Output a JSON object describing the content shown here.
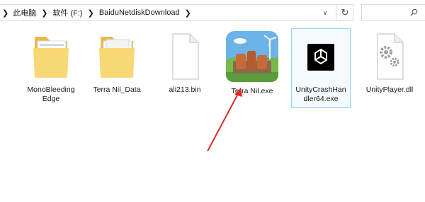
{
  "address": {
    "crumbs": [
      "此电脑",
      "软件 (F:)",
      "BaiduNetdiskDownload"
    ],
    "refresh_icon": "refresh-icon",
    "dropdown_icon": "chevron-down-icon"
  },
  "search": {
    "placeholder": "",
    "icon": "search-icon"
  },
  "files": [
    {
      "label": "MonoBleeding\nEdge",
      "type": "folder"
    },
    {
      "label": "Terra Nil_Data",
      "type": "folder"
    },
    {
      "label": "ali213.bin",
      "type": "file"
    },
    {
      "label": "Terra Nil.exe",
      "type": "app"
    },
    {
      "label": "UnityCrashHan\ndler64.exe",
      "type": "unity",
      "selected": true
    },
    {
      "label": "UnityPlayer.dll",
      "type": "dll"
    }
  ],
  "annotation": {
    "color": "#e0292b"
  }
}
